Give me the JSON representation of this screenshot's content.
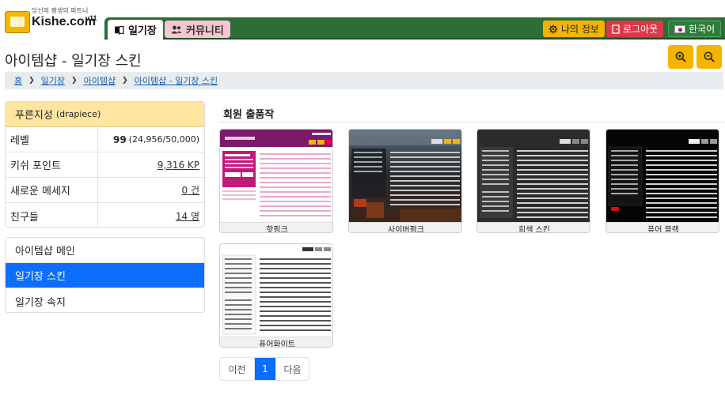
{
  "logo": {
    "tagline": "당신의 평생의 파트너",
    "name": "Kishe.com",
    "version": "v11"
  },
  "nav": {
    "tabs": [
      {
        "label": "일기장",
        "icon": "book-icon"
      },
      {
        "label": "커뮤니티",
        "icon": "users-icon"
      }
    ],
    "my_info": "나의 정보",
    "logout": "로그아웃",
    "language": "한국어"
  },
  "page": {
    "title": "아이템샵 - 일기장 스킨"
  },
  "breadcrumb": [
    "홈",
    "일기장",
    "아이템샵",
    "아이템샵 - 일기장 스킨"
  ],
  "profile": {
    "name": "푸른지성",
    "id": "(drapiece)",
    "rows": [
      {
        "label": "레벨",
        "value": "99",
        "detail": "(24,956/50,000)"
      },
      {
        "label": "키쉬 포인트",
        "value": "9,316 KP"
      },
      {
        "label": "새로운 메세지",
        "value": "0 건"
      },
      {
        "label": "친구들",
        "value": "14 명"
      }
    ]
  },
  "menu": [
    {
      "label": "아이템샵 메인",
      "active": false
    },
    {
      "label": "일기장 스킨",
      "active": true
    },
    {
      "label": "일기장 속지",
      "active": false
    }
  ],
  "section": {
    "title": "회원 출품작"
  },
  "skins": [
    {
      "name": "핫핑크",
      "theme": "hotpink"
    },
    {
      "name": "사이버펑크",
      "theme": "cyberpunk"
    },
    {
      "name": "회색 스킨",
      "theme": "gray"
    },
    {
      "name": "퓨어 블랙",
      "theme": "black"
    },
    {
      "name": "퓨어화이트",
      "theme": "white"
    }
  ],
  "pagination": {
    "prev": "이전",
    "current": "1",
    "next": "다음"
  },
  "colors": {
    "nav_green": "#2c6e36",
    "accent_yellow": "#f5b400",
    "primary_blue": "#0d6efd",
    "logout_red": "#d93a4a",
    "community_pink": "#f8c6d0",
    "hotpink": "#c2187a"
  }
}
